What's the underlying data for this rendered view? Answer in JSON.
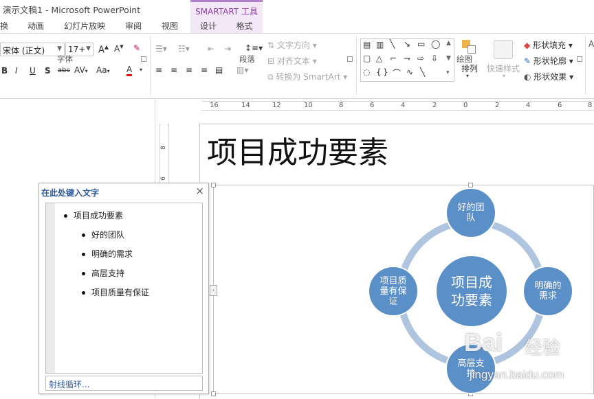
{
  "window": {
    "title": "演示文稿1 - Microsoft PowerPoint",
    "context_tab_group": "SMARTART 工具"
  },
  "tabs": [
    "换",
    "动画",
    "幻灯片放映",
    "审阅",
    "视图",
    "设计",
    "格式"
  ],
  "ribbon": {
    "font_group": {
      "label": "字体",
      "font_name": "宋体 (正文)",
      "font_size": "17+"
    },
    "paragraph_group": {
      "label": "段落",
      "text_direction": "文字方向",
      "align_text": "对齐文本",
      "convert_smartart": "转换为 SmartArt"
    },
    "drawing_group": {
      "label": "绘图",
      "arrange": "排列",
      "quick_styles": "快速样式",
      "shape_fill": "形状填充",
      "shape_outline": "形状轮廓",
      "shape_effects": "形状效果"
    }
  },
  "ruler": {
    "h_labels": [
      "16",
      "14",
      "12",
      "10",
      "8",
      "6",
      "4",
      "2",
      "0",
      "2",
      "4",
      "6",
      "8"
    ],
    "v_labels": [
      "8",
      "6"
    ]
  },
  "slide": {
    "title": "项目成功要素"
  },
  "text_pane": {
    "title": "在此处键入文字",
    "items": [
      {
        "text": "项目成功要素",
        "level": 1
      },
      {
        "text": "好的团队",
        "level": 2
      },
      {
        "text": "明确的需求",
        "level": 2
      },
      {
        "text": "高层支持",
        "level": 2
      },
      {
        "text": "项目质量有保证",
        "level": 2
      }
    ],
    "layout_name": "射线循环..."
  },
  "diagram": {
    "center": [
      "项目成",
      "功要素"
    ],
    "top": [
      "好的团",
      "队"
    ],
    "right": [
      "明确的",
      "需求"
    ],
    "bottom": [
      "高层支",
      "持"
    ],
    "left": [
      "项目质",
      "量有保",
      "证"
    ],
    "colors": {
      "node": "#5b8fc7",
      "ring": "#aec4df"
    }
  },
  "watermark": {
    "brand": "Bai",
    "cn": "经验",
    "url": "jingyan.baidu.com"
  }
}
